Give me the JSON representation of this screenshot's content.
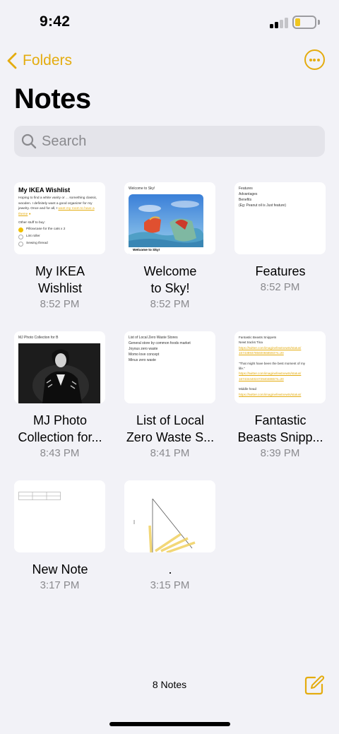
{
  "status": {
    "time": "9:42",
    "battery_level": 0.25
  },
  "nav": {
    "back_label": "Folders"
  },
  "title": "Notes",
  "search": {
    "placeholder": "Search"
  },
  "notes": [
    {
      "title": "My IKEA\nWishlist",
      "time": "8:52 PM",
      "preview": {
        "heading": "My IKEA Wishlist",
        "body": "Hoping to find a white vanity or ... something classic, wooden. I definitely want a good organizer for my jewelry. Once and for all, I",
        "link": "want my room to have a theme",
        "list_title": "Other stuff to buy:",
        "items": [
          {
            "label": "Pillowcase for the cats x 2",
            "checked": true
          },
          {
            "label": "Lint roller",
            "checked": false
          },
          {
            "label": "Sewing thread",
            "checked": false
          }
        ]
      }
    },
    {
      "title": "Welcome\nto Sky!",
      "time": "8:52 PM",
      "preview": {
        "heading": "Welcome to Sky!",
        "caption": "Welcome to Sky!"
      }
    },
    {
      "title": "Features",
      "time": "8:52 PM",
      "preview": {
        "lines": [
          "Features",
          "Advantages",
          "Benefits",
          "(Eg: Peanut oil is Just feature)"
        ]
      }
    },
    {
      "title": "MJ Photo\nCollection for...",
      "time": "8:43 PM",
      "preview": {
        "heading": "MJ Photo Collection for B"
      }
    },
    {
      "title": "List of Local\nZero Waste S...",
      "time": "8:41 PM",
      "preview": {
        "lines": [
          "List of Local Zero Waste Stores",
          "General store by common foods market",
          "Joyous zero waste",
          "Momo love concept",
          "Minus zero waste"
        ]
      }
    },
    {
      "title": "Fantastic\nBeasts Snipp...",
      "time": "8:39 PM",
      "preview": {
        "heading": "Fantastic Beasts Snippets",
        "subheading": "Newt tracks Tina",
        "link1a": "https://twitter.com/imaginefewtnewts/status/",
        "link1b": "16743893785600668593?s=20",
        "quote1": "\"That might have been the best moment of my",
        "quote2": "life.\"",
        "link2a": "https://twitter.com/imaginefewtnewts/status/",
        "link2b": "16743444024729404865?s=20",
        "section": "Middle head",
        "link3a": "https://twitter.com/imaginefewtnewts/status/"
      }
    },
    {
      "title": "New Note",
      "time": "3:17 PM"
    },
    {
      "title": ".",
      "time": "3:15 PM"
    }
  ],
  "footer": {
    "count": "8 Notes"
  },
  "colors": {
    "accent": "#e4ac0f",
    "background": "#f2f2f7",
    "card": "#ffffff",
    "secondary_text": "#8a8a8e"
  },
  "icons": [
    "chevron-left-icon",
    "ellipsis-circle-icon",
    "search-icon",
    "compose-icon",
    "signal-icon",
    "battery-icon"
  ]
}
